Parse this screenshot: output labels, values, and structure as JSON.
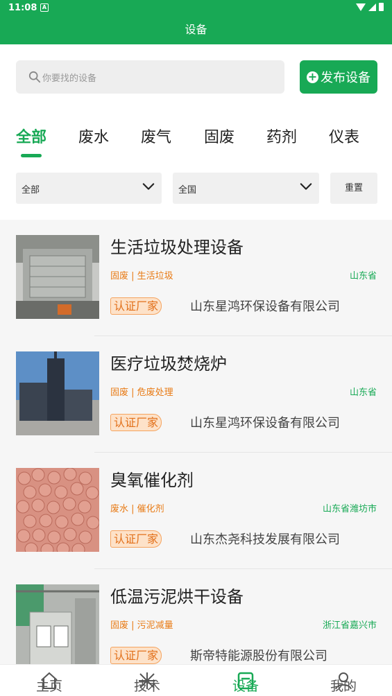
{
  "status_bar": {
    "time": "11:08",
    "notification_glyph": "A"
  },
  "header": {
    "title": "设备"
  },
  "search": {
    "placeholder": "你要找的设备"
  },
  "publish_button": {
    "label": "发布设备"
  },
  "tabs": [
    {
      "label": "全部",
      "active": true
    },
    {
      "label": "废水",
      "active": false
    },
    {
      "label": "废气",
      "active": false
    },
    {
      "label": "固废",
      "active": false
    },
    {
      "label": "药剂",
      "active": false
    },
    {
      "label": "仪表",
      "active": false
    }
  ],
  "filters": {
    "category": {
      "value": "全部"
    },
    "region": {
      "value": "全国"
    },
    "reset_label": "重置"
  },
  "items": [
    {
      "title": "生活垃圾处理设备",
      "tags": "固废 | 生活垃圾",
      "location": "山东省",
      "badge": "认证厂家",
      "company": "山东星鸿环保设备有限公司"
    },
    {
      "title": "医疗垃圾焚烧炉",
      "tags": "固废 | 危废处理",
      "location": "山东省",
      "badge": "认证厂家",
      "company": "山东星鸿环保设备有限公司"
    },
    {
      "title": "臭氧催化剂",
      "tags": "废水 | 催化剂",
      "location": "山东省潍坊市",
      "badge": "认证厂家",
      "company": "山东杰尧科技发展有限公司"
    },
    {
      "title": "低温污泥烘干设备",
      "tags": "固废 | 污泥减量",
      "location": "浙江省嘉兴市",
      "badge": "认证厂家",
      "company": "斯帝特能源股份有限公司"
    }
  ],
  "bottom_nav": [
    {
      "label": "主页",
      "icon": "home-icon",
      "active": false
    },
    {
      "label": "技术",
      "icon": "tech-icon",
      "active": false
    },
    {
      "label": "设备",
      "icon": "device-icon",
      "active": true
    },
    {
      "label": "我的",
      "icon": "profile-icon",
      "active": false
    }
  ],
  "colors": {
    "brand": "#18a955",
    "tag": "#e87a14",
    "badge_bg": "#fde2c9"
  }
}
